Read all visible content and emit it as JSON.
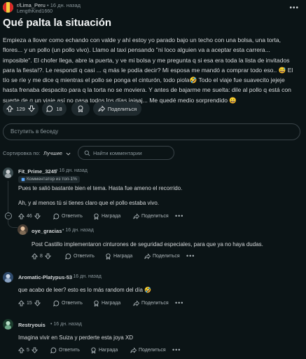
{
  "post": {
    "subreddit": "r/Lima_Peru",
    "separator": "•",
    "time": "16 дн. назад",
    "author": "LengthKind1660",
    "more": "•••",
    "title": "Qué palta la situación",
    "body": "Empieza a llover como echando con valde y ahí estoy yo parado bajo un techo con una bolsa, una torta, flores... y un pollo (un pollo vivo). Llamo al taxi pensando \"ni loco alguien va a aceptar esta carrera... imposible\". El chofer llega, abre la puerta, y ve mi bolsa y me pregunta q si esa era toda la lista de invitados para la fiesta!?. Le respondí q casi ... q más le podía decir? Mi esposa me mandó a comprar todo eso.. 😅 El tío se ríe y me dice q mientras el pollo se ponga el cinturón, todo piola🤣 Todo el viaje fue suavecito jejeje hasta frenaba despacito para q la torta no se moviera. Y antes de bajarme me suelta: dile al pollo q está con suerte de q un viaje así no pasa todos los días jajaaj... Me quedé medio sorprendido 😀",
    "votes": "129",
    "comments": "18",
    "share": "Поделиться"
  },
  "comment_box": {
    "placeholder": "Вступить в беседу"
  },
  "sort": {
    "label": "Сортировка по:",
    "value": "Лучшие",
    "search_placeholder": "Найти комментарии"
  },
  "actions": {
    "reply": "Ответить",
    "award": "Награда",
    "share": "Поделиться"
  },
  "comments": [
    {
      "user": "Fit_Prime_3245",
      "time": "16 дн. назад",
      "flair": "Комментатор из топ-1%",
      "lines": [
        "Pues te salió bastante bien el tema. Hasta fue ameno el recorrido.",
        "Ah, y al menos tú si tienes claro que el pollo estaba vivo."
      ],
      "votes": "46"
    },
    {
      "user": "oye_gracias",
      "time": "16 дн. назад",
      "lines": [
        "Post Castillo implementaron cinturones de seguridad especiales, para que ya no haya dudas."
      ],
      "votes": "8"
    },
    {
      "user": "Aromatic-Platypus-53",
      "time": "16 дн. назад",
      "lines": [
        "que acabo de leer? esto es lo más random del día 🤣"
      ],
      "votes": "15"
    },
    {
      "user": "Restryouis",
      "time": "16 дн. назад",
      "lines": [
        "Imagina vivir en Suiza y perderte esta joya XD"
      ],
      "votes": "5"
    }
  ],
  "colors": {
    "background": "#0b1416",
    "pill": "#1f2a2e",
    "text": "#d7dadc",
    "muted": "#8b979c"
  }
}
